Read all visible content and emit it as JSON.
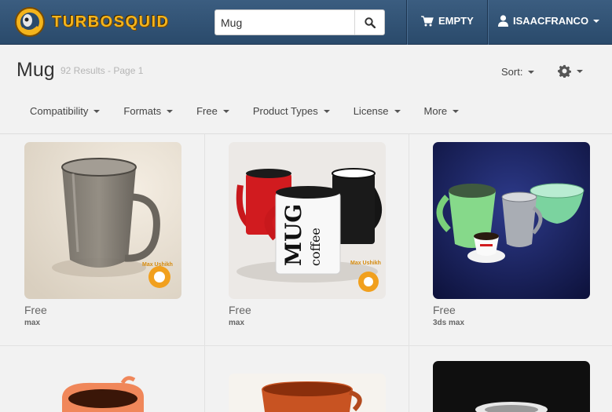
{
  "header": {
    "brand": "TurboSquid",
    "search": {
      "value": "Mug",
      "placeholder": ""
    },
    "cart_label": "EMPTY",
    "user_label": "ISAACFRANCO"
  },
  "page": {
    "title": "Mug",
    "results_info": "92 Results - Page 1",
    "sort_label": "Sort:"
  },
  "filters": [
    "Compatibility",
    "Formats",
    "Free",
    "Product Types",
    "License",
    "More"
  ],
  "products": [
    {
      "price": "Free",
      "format": "max",
      "watermark": "Max Ushikh"
    },
    {
      "price": "Free",
      "format": "max",
      "watermark": "Max Ushikh",
      "mug_text": [
        "MUG",
        "coffee"
      ]
    },
    {
      "price": "Free",
      "format": "3ds max"
    },
    {
      "price": "",
      "format": ""
    },
    {
      "price": "",
      "format": ""
    },
    {
      "price": "",
      "format": ""
    }
  ],
  "colors": {
    "nav_bg": "#2f5173",
    "brand": "#f4b41c",
    "page_bg": "#f2f2f2"
  }
}
